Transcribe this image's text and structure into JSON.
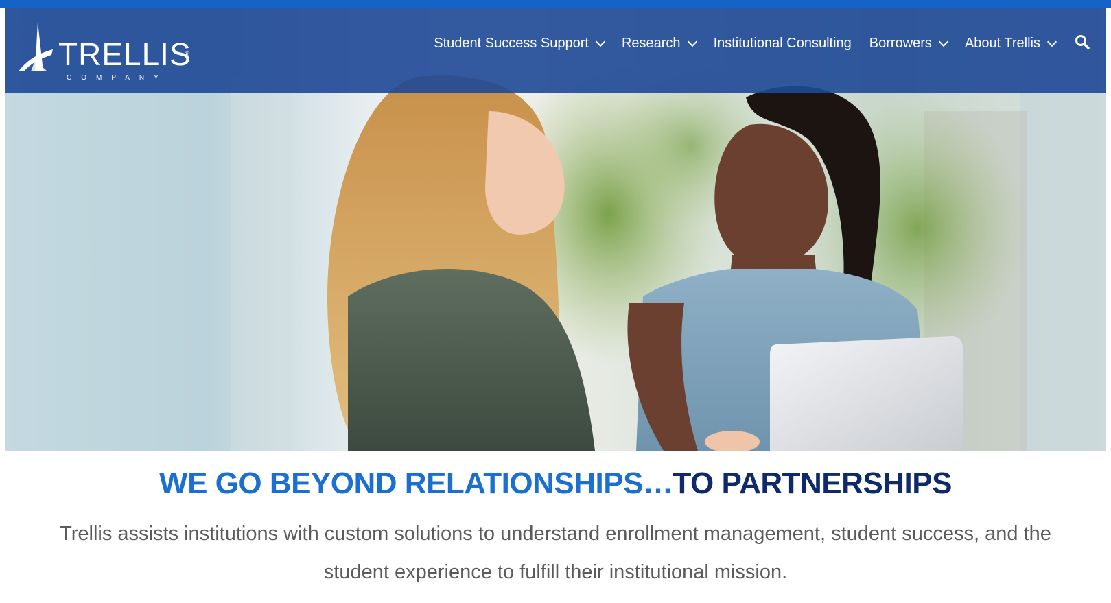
{
  "brand": {
    "name": "TRELLIS",
    "sub": "COMPANY",
    "reg": "®"
  },
  "nav": {
    "items": [
      {
        "label": "Student Success Support",
        "dropdown": true
      },
      {
        "label": "Research",
        "dropdown": true
      },
      {
        "label": "Institutional Consulting",
        "dropdown": false
      },
      {
        "label": "Borrowers",
        "dropdown": true
      },
      {
        "label": "About Trellis",
        "dropdown": true
      }
    ],
    "search_icon": "search-icon"
  },
  "hero": {
    "image": "two-women-talking-with-laptop"
  },
  "content": {
    "headline_part1": "WE GO BEYOND RELATIONSHIPS…",
    "headline_part2": "TO PARTNERSHIPS",
    "description": "Trellis assists institutions with custom solutions to understand enrollment management, student success, and the student experience to fulfill their institutional mission."
  },
  "colors": {
    "top_bar": "#1464c8",
    "nav_bg": "#1e4896",
    "headline_light": "#1b6fd0",
    "headline_dark": "#0e2a6b",
    "body_text": "#5b5b5b"
  }
}
